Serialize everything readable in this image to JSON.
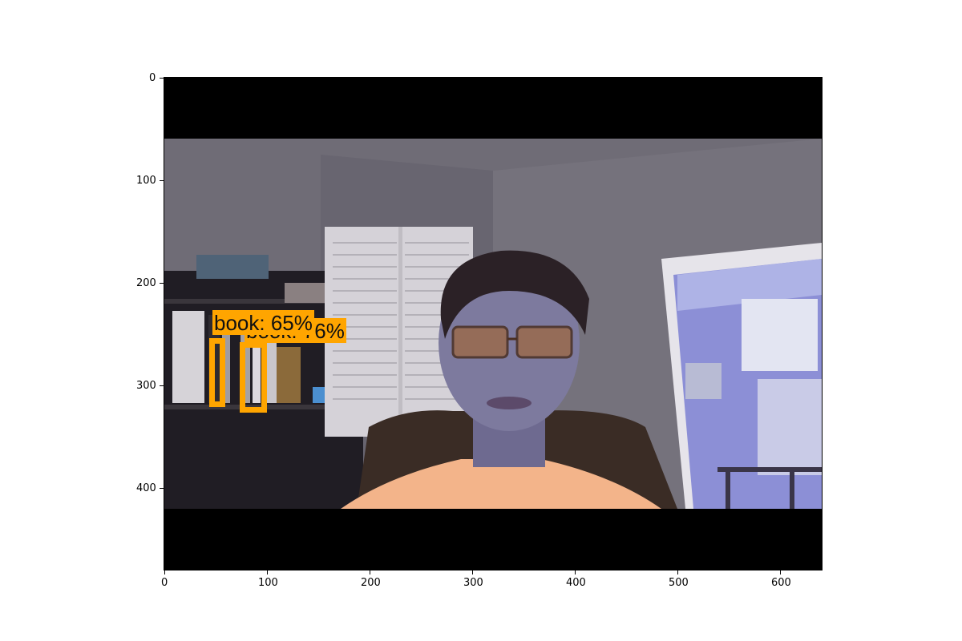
{
  "figure": {
    "x_ticks": [
      "0",
      "100",
      "200",
      "300",
      "400",
      "500",
      "600"
    ],
    "y_ticks": [
      "0",
      "100",
      "200",
      "300",
      "400"
    ]
  },
  "detections": [
    {
      "label": "book: 65%"
    },
    {
      "label": "book: 76%"
    }
  ],
  "colors": {
    "box": "#ffa500",
    "wall": "#6a6770",
    "face": "#7d7a9e",
    "shirt": "#f3b48a"
  }
}
